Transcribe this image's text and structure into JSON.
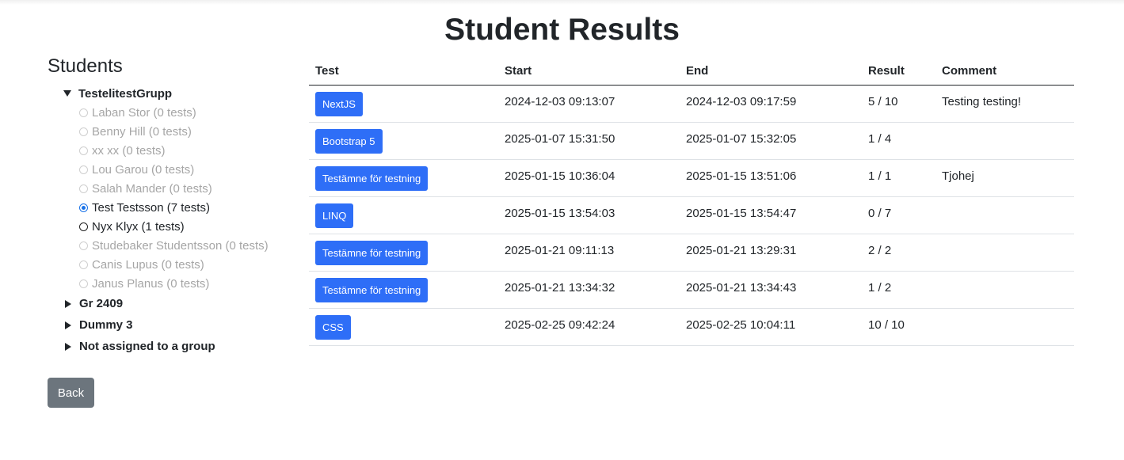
{
  "page_title": "Student Results",
  "students_heading": "Students",
  "groups": [
    {
      "name": "TestelitestGrupp",
      "expanded": true,
      "students": [
        {
          "label": "Laban Stor (0 tests)",
          "state": "disabled"
        },
        {
          "label": "Benny Hill (0 tests)",
          "state": "disabled"
        },
        {
          "label": "xx xx (0 tests)",
          "state": "disabled"
        },
        {
          "label": "Lou Garou (0 tests)",
          "state": "disabled"
        },
        {
          "label": "Salah Mander (0 tests)",
          "state": "disabled"
        },
        {
          "label": "Test Testsson (7 tests)",
          "state": "checked"
        },
        {
          "label": "Nyx Klyx (1 tests)",
          "state": "enabled"
        },
        {
          "label": "Studebaker Studentsson (0 tests)",
          "state": "disabled"
        },
        {
          "label": "Canis Lupus (0 tests)",
          "state": "disabled"
        },
        {
          "label": "Janus Planus (0 tests)",
          "state": "disabled"
        }
      ]
    },
    {
      "name": "Gr 2409",
      "expanded": false
    },
    {
      "name": "Dummy 3",
      "expanded": false
    },
    {
      "name": "Not assigned to a group",
      "expanded": false
    }
  ],
  "back_label": "Back",
  "table": {
    "headers": [
      "Test",
      "Start",
      "End",
      "Result",
      "Comment"
    ],
    "rows": [
      {
        "test": "NextJS",
        "start": "2024-12-03 09:13:07",
        "end": "2024-12-03 09:17:59",
        "result": "5 / 10",
        "comment": "Testing testing!"
      },
      {
        "test": "Bootstrap 5",
        "start": "2025-01-07 15:31:50",
        "end": "2025-01-07 15:32:05",
        "result": "1 / 4",
        "comment": ""
      },
      {
        "test": "Testämne för testning",
        "start": "2025-01-15 10:36:04",
        "end": "2025-01-15 13:51:06",
        "result": "1 / 1",
        "comment": "Tjohej"
      },
      {
        "test": "LINQ",
        "start": "2025-01-15 13:54:03",
        "end": "2025-01-15 13:54:47",
        "result": "0 / 7",
        "comment": ""
      },
      {
        "test": "Testämne för testning",
        "start": "2025-01-21 09:11:13",
        "end": "2025-01-21 13:29:31",
        "result": "2 / 2",
        "comment": ""
      },
      {
        "test": "Testämne för testning",
        "start": "2025-01-21 13:34:32",
        "end": "2025-01-21 13:34:43",
        "result": "1 / 2",
        "comment": ""
      },
      {
        "test": "CSS",
        "start": "2025-02-25 09:42:24",
        "end": "2025-02-25 10:04:11",
        "result": "10 / 10",
        "comment": ""
      }
    ]
  },
  "colors": {
    "primary_button": "#2e6ef7",
    "secondary_button": "#6c757d",
    "radio_checked": "#1a73e8"
  }
}
